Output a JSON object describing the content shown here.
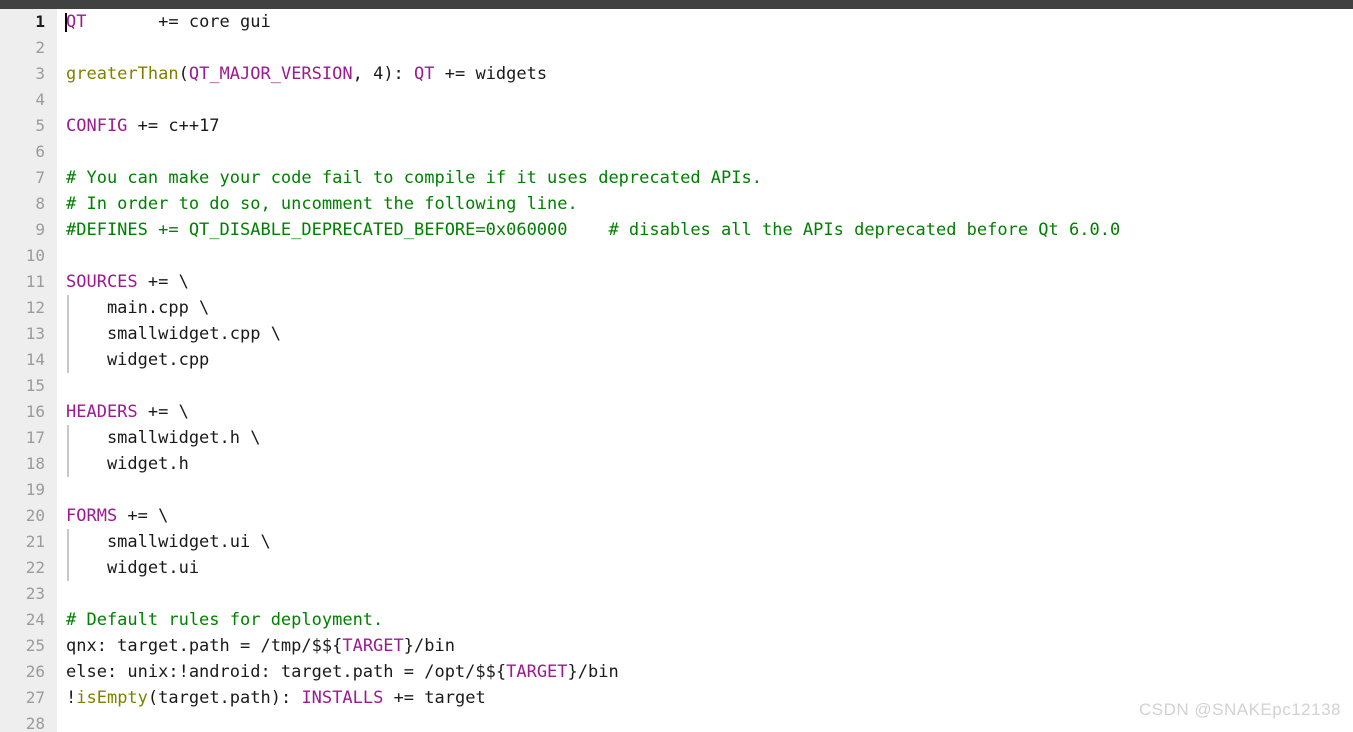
{
  "window": {
    "titlebar_color": "#414141",
    "background_color": "#ffffff",
    "gutter_color": "#eeeeee"
  },
  "colors": {
    "variable": "#9b1a8f",
    "function": "#808000",
    "comment": "#008000",
    "plain": "#1a1a1a",
    "line_number": "#9b9b9b",
    "line_number_current": "#1a1a1a",
    "indent_guide": "#c8c8c8",
    "watermark": "#d2d2d2"
  },
  "editor": {
    "language": "qmake",
    "current_line": 1,
    "caret_line": 1,
    "caret_column": 1,
    "total_visible_lines": 28,
    "lines": [
      {
        "n": "1",
        "current": true,
        "guide": false,
        "tokens": [
          {
            "t": "QT",
            "c": "var"
          },
          {
            "t": "       += core gui",
            "c": "plain"
          }
        ]
      },
      {
        "n": "2",
        "current": false,
        "guide": false,
        "tokens": []
      },
      {
        "n": "3",
        "current": false,
        "guide": false,
        "tokens": [
          {
            "t": "greaterThan",
            "c": "func"
          },
          {
            "t": "(",
            "c": "plain"
          },
          {
            "t": "QT_MAJOR_VERSION",
            "c": "var"
          },
          {
            "t": ", 4): ",
            "c": "plain"
          },
          {
            "t": "QT",
            "c": "var"
          },
          {
            "t": " += widgets",
            "c": "plain"
          }
        ]
      },
      {
        "n": "4",
        "current": false,
        "guide": false,
        "tokens": []
      },
      {
        "n": "5",
        "current": false,
        "guide": false,
        "tokens": [
          {
            "t": "CONFIG",
            "c": "var"
          },
          {
            "t": " += c++17",
            "c": "plain"
          }
        ]
      },
      {
        "n": "6",
        "current": false,
        "guide": false,
        "tokens": []
      },
      {
        "n": "7",
        "current": false,
        "guide": false,
        "tokens": [
          {
            "t": "# You can make your code fail to compile if it uses deprecated APIs.",
            "c": "cmt"
          }
        ]
      },
      {
        "n": "8",
        "current": false,
        "guide": false,
        "tokens": [
          {
            "t": "# In order to do so, uncomment the following line.",
            "c": "cmt"
          }
        ]
      },
      {
        "n": "9",
        "current": false,
        "guide": false,
        "tokens": [
          {
            "t": "#DEFINES += QT_DISABLE_DEPRECATED_BEFORE=0x060000    # disables all the APIs deprecated before Qt 6.0.0",
            "c": "cmt"
          }
        ]
      },
      {
        "n": "10",
        "current": false,
        "guide": false,
        "tokens": []
      },
      {
        "n": "11",
        "current": false,
        "guide": false,
        "tokens": [
          {
            "t": "SOURCES",
            "c": "var"
          },
          {
            "t": " += \\",
            "c": "plain"
          }
        ]
      },
      {
        "n": "12",
        "current": false,
        "guide": true,
        "tokens": [
          {
            "t": "    main.cpp \\",
            "c": "plain"
          }
        ]
      },
      {
        "n": "13",
        "current": false,
        "guide": true,
        "tokens": [
          {
            "t": "    smallwidget.cpp \\",
            "c": "plain"
          }
        ]
      },
      {
        "n": "14",
        "current": false,
        "guide": true,
        "tokens": [
          {
            "t": "    widget.cpp",
            "c": "plain"
          }
        ]
      },
      {
        "n": "15",
        "current": false,
        "guide": false,
        "tokens": []
      },
      {
        "n": "16",
        "current": false,
        "guide": false,
        "tokens": [
          {
            "t": "HEADERS",
            "c": "var"
          },
          {
            "t": " += \\",
            "c": "plain"
          }
        ]
      },
      {
        "n": "17",
        "current": false,
        "guide": true,
        "tokens": [
          {
            "t": "    smallwidget.h \\",
            "c": "plain"
          }
        ]
      },
      {
        "n": "18",
        "current": false,
        "guide": true,
        "tokens": [
          {
            "t": "    widget.h",
            "c": "plain"
          }
        ]
      },
      {
        "n": "19",
        "current": false,
        "guide": false,
        "tokens": []
      },
      {
        "n": "20",
        "current": false,
        "guide": false,
        "tokens": [
          {
            "t": "FORMS",
            "c": "var"
          },
          {
            "t": " += \\",
            "c": "plain"
          }
        ]
      },
      {
        "n": "21",
        "current": false,
        "guide": true,
        "tokens": [
          {
            "t": "    smallwidget.ui \\",
            "c": "plain"
          }
        ]
      },
      {
        "n": "22",
        "current": false,
        "guide": true,
        "tokens": [
          {
            "t": "    widget.ui",
            "c": "plain"
          }
        ]
      },
      {
        "n": "23",
        "current": false,
        "guide": false,
        "tokens": []
      },
      {
        "n": "24",
        "current": false,
        "guide": false,
        "tokens": [
          {
            "t": "# Default rules for deployment.",
            "c": "cmt"
          }
        ]
      },
      {
        "n": "25",
        "current": false,
        "guide": false,
        "tokens": [
          {
            "t": "qnx: target.path = /tmp/$${",
            "c": "plain"
          },
          {
            "t": "TARGET",
            "c": "var"
          },
          {
            "t": "}/bin",
            "c": "plain"
          }
        ]
      },
      {
        "n": "26",
        "current": false,
        "guide": false,
        "tokens": [
          {
            "t": "else: unix:!android: target.path = /opt/$${",
            "c": "plain"
          },
          {
            "t": "TARGET",
            "c": "var"
          },
          {
            "t": "}/bin",
            "c": "plain"
          }
        ]
      },
      {
        "n": "27",
        "current": false,
        "guide": false,
        "tokens": [
          {
            "t": "!",
            "c": "plain"
          },
          {
            "t": "isEmpty",
            "c": "func"
          },
          {
            "t": "(target.path): ",
            "c": "plain"
          },
          {
            "t": "INSTALLS",
            "c": "var"
          },
          {
            "t": " += target",
            "c": "plain"
          }
        ]
      },
      {
        "n": "28",
        "current": false,
        "guide": false,
        "tokens": []
      }
    ]
  },
  "watermark": {
    "text": "CSDN @SNAKEpc12138"
  }
}
